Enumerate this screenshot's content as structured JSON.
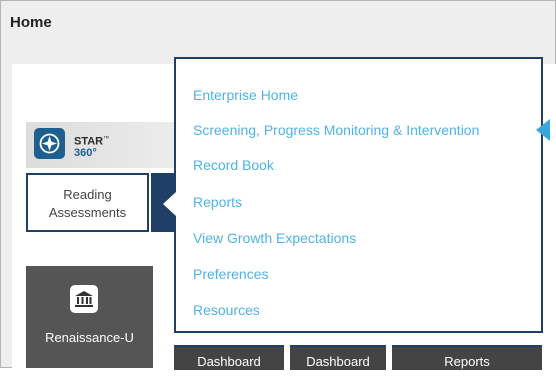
{
  "page": {
    "title": "Home"
  },
  "star": {
    "line1": "STAR",
    "tm": "™",
    "line2": "360°"
  },
  "reading": {
    "line1": "Reading",
    "line2": "Assessments"
  },
  "renaissance_u": {
    "label": "Renaissance-U",
    "icon": "institution-icon"
  },
  "tabs": [
    {
      "label": "Dashboard"
    },
    {
      "label": "Dashboard"
    },
    {
      "label": "Reports"
    }
  ],
  "menu": {
    "items": [
      {
        "label": "Enterprise Home"
      },
      {
        "label": "Screening, Progress Monitoring & Intervention"
      },
      {
        "label": "Record Book"
      },
      {
        "label": "Reports"
      },
      {
        "label": "View Growth Expectations"
      },
      {
        "label": "Preferences"
      },
      {
        "label": "Resources"
      }
    ]
  },
  "colors": {
    "accent": "#4fb3e6",
    "navy": "#1f3f66",
    "dark": "#555555",
    "star_blue": "#1d5f8e"
  }
}
